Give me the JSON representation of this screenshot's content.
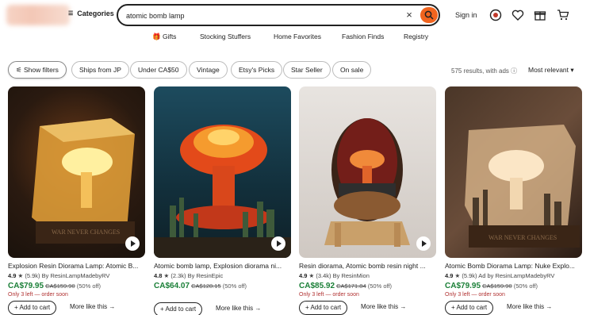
{
  "header": {
    "categories_label": "Categories",
    "search_value": "atomic bomb lamp",
    "signin_label": "Sign in"
  },
  "nav": {
    "items": [
      "Gifts",
      "Stocking Stuffers",
      "Home Favorites",
      "Fashion Finds",
      "Registry"
    ]
  },
  "filters": {
    "chips": [
      "Show filters",
      "Ships from JP",
      "Under CA$50",
      "Vintage",
      "Etsy's Picks",
      "Star Seller",
      "On sale"
    ],
    "results_text": "575 results, with ads",
    "sort_label": "Most relevant"
  },
  "products": [
    {
      "title": "Explosion Resin Diorama Lamp: Atomic B...",
      "rating": "4.9",
      "reviews": "(5.9k)",
      "seller": "By ResinLampMadebyRV",
      "price": "CA$79.95",
      "original_price": "CA$159.90",
      "discount": "(50% off)",
      "stock": "Only 3 left — order soon",
      "add_label": "+ Add to cart",
      "more_label": "More like this"
    },
    {
      "title": "Atomic bomb lamp, Explosion diorama ni...",
      "rating": "4.8",
      "reviews": "(2.3k)",
      "seller": "By ResinEpic",
      "price": "CA$64.07",
      "original_price": "CA$128.15",
      "discount": "(50% off)",
      "stock": "",
      "add_label": "+ Add to cart",
      "more_label": "More like this"
    },
    {
      "title": "Resin diorama, Atomic bomb resin night ...",
      "rating": "4.9",
      "reviews": "(3.4k)",
      "seller": "By ResinMion",
      "price": "CA$85.92",
      "original_price": "CA$171.84",
      "discount": "(50% off)",
      "stock": "Only 3 left — order soon",
      "add_label": "+ Add to cart",
      "more_label": "More like this"
    },
    {
      "title": "Atomic Bomb Diorama Lamp: Nuke Explo...",
      "rating": "4.9",
      "reviews": "(5.9k)",
      "seller": "Ad by ResinLampMadebyRV",
      "price": "CA$79.95",
      "original_price": "CA$159.90",
      "discount": "(50% off)",
      "stock": "Only 3 left — order soon",
      "add_label": "+ Add to cart",
      "more_label": "More like this"
    }
  ],
  "colors": {
    "accent": "#f1641e",
    "price": "#1a7f37",
    "stock": "#b03030"
  }
}
